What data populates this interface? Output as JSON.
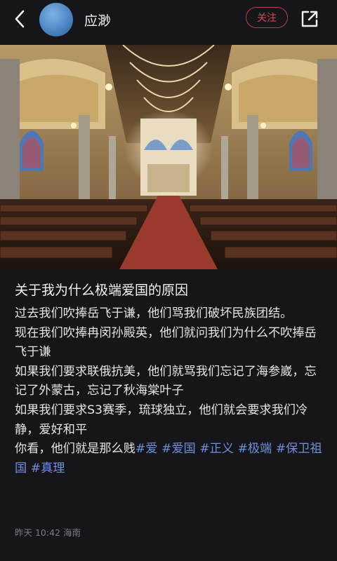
{
  "header": {
    "username": "应渺",
    "follow_label": "关注"
  },
  "post": {
    "title": "关于我为什么极端爱国的原因",
    "paragraphs": [
      "过去我们吹捧岳飞于谦，他们骂我们破坏民族团结。",
      "现在我们吹捧冉闵孙殿英，他们就问我们为什么不吹捧岳飞于谦",
      "如果我们要求联俄抗美，他们就骂我们忘记了海参崴，忘记了外蒙古，忘记了秋海棠叶子",
      "如果我们要求S3赛季，琉球独立，他们就会要求我们冷静，爱好和平"
    ],
    "last_text": "你看，他们就是那么贱",
    "tags": [
      "#爱",
      "#爱国",
      "#正义",
      "#极端",
      "#保卫祖国",
      "#真理"
    ],
    "meta": "昨天 10:42 海南"
  },
  "icons": {
    "back": "chevron-left-icon",
    "share": "share-icon"
  },
  "colors": {
    "background": "#16161a",
    "follow_accent": "#e0454f",
    "tag": "#6f8fd6"
  }
}
